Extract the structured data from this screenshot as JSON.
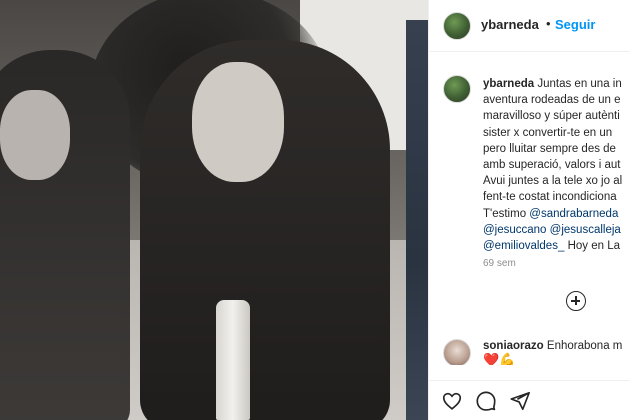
{
  "post": {
    "photo_alt": "",
    "header": {
      "username": "ybarneda",
      "separator": "•",
      "follow_label": "Seguir"
    },
    "caption": {
      "username": "ybarneda",
      "lines": [
        "Juntas en una in",
        "aventura rodeadas de un e",
        "maravilloso y súper autènti",
        "sister x convertir-te en un",
        "pero lluitar sempre des de",
        "amb superació, valors i aut",
        "Avui juntes a la tele xo jo al",
        "fent-te costat incondiciona",
        "T'estimo"
      ],
      "mention_1": "@sandrabarneda",
      "mention_2": "@jesuccano",
      "mention_3": "@jesuscalleja",
      "mention_4": "@emiliovaldes_",
      "tail_text": "Hoy en La"
    },
    "time_ago": "69 sem",
    "load_more_icon": "plus-circle-icon",
    "comment": {
      "username": "soniaorazo",
      "text": "Enhorabona m",
      "emojis": "❤️💪"
    },
    "actions": {
      "like_icon": "heart-icon",
      "comment_icon": "comment-icon",
      "share_icon": "share-icon"
    }
  }
}
